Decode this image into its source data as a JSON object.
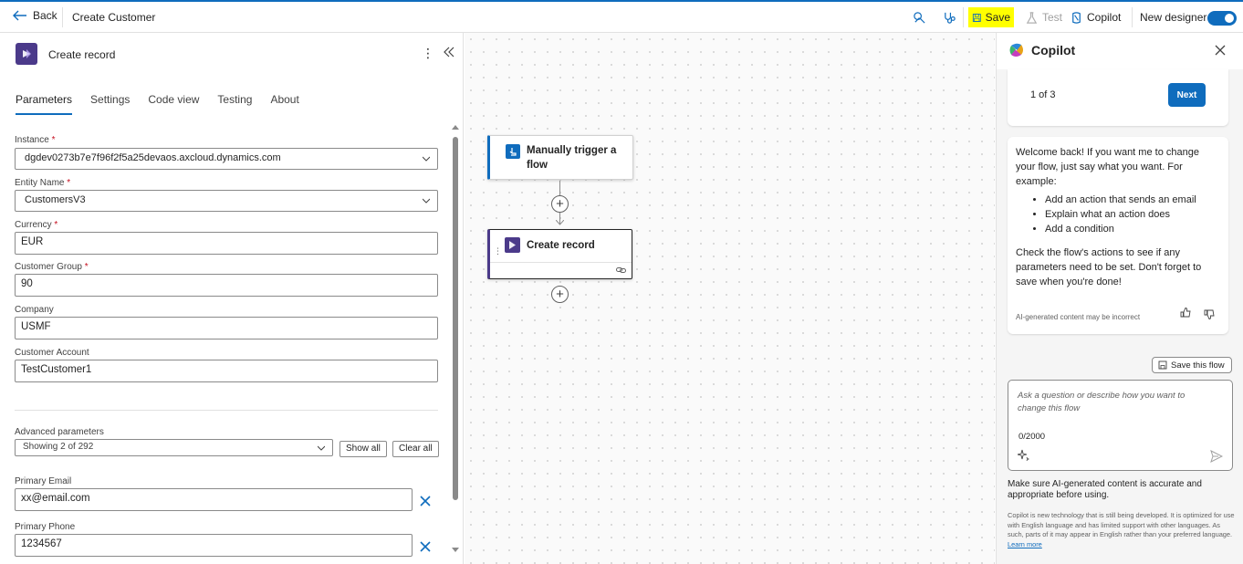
{
  "topbar": {
    "back_label": "Back",
    "title": "Create Customer",
    "save_label": "Save",
    "test_label": "Test",
    "copilot_label": "Copilot",
    "new_designer_label": "New designer",
    "new_designer_on": true
  },
  "panel": {
    "title": "Create record",
    "tabs": [
      "Parameters",
      "Settings",
      "Code view",
      "Testing",
      "About"
    ],
    "fields": {
      "instance": {
        "label": "Instance",
        "value": "dgdev0273b7e7f96f2f5a25devaos.axcloud.dynamics.com"
      },
      "entity": {
        "label": "Entity Name",
        "value": "CustomersV3"
      },
      "currency": {
        "label": "Currency",
        "value": "EUR"
      },
      "customer_group": {
        "label": "Customer Group",
        "value": "90"
      },
      "company": {
        "label": "Company",
        "value": "USMF"
      },
      "customer_account": {
        "label": "Customer Account",
        "value": "TestCustomer1"
      },
      "primary_email": {
        "label": "Primary Email",
        "value": "xx@email.com"
      },
      "primary_phone": {
        "label": "Primary Phone",
        "value": "1234567"
      }
    },
    "required_mark": "*",
    "advanced": {
      "label": "Advanced parameters",
      "value": "Showing 2 of 292",
      "show_all": "Show all",
      "clear_all": "Clear all"
    }
  },
  "canvas": {
    "trigger_label": "Manually trigger a flow",
    "action_label": "Create record"
  },
  "copilot": {
    "title": "Copilot",
    "pager": "1 of 3",
    "next_label": "Next",
    "welcome": "Welcome back! If you want me to change your flow, just say what you want. For example:",
    "examples": [
      "Add an action that sends an email",
      "Explain what an action does",
      "Add a condition"
    ],
    "check": "Check the flow's actions to see if any parameters need to be set. Don't forget to save when you're done!",
    "ai_note": "AI-generated content may be incorrect",
    "save_flow": "Save this flow",
    "input_placeholder": "Ask a question or describe how you want to change this flow",
    "counter": "0/2000",
    "disclaimer": "Make sure AI-generated content is accurate and appropriate before using.",
    "footnote": "Copilot is new technology that is still being developed. It is optimized for use with English language and has limited support with other languages. As such, parts of it may appear in English rather than your preferred language.",
    "learn_more": "Learn more"
  },
  "colors": {
    "accent": "#0f6cbd",
    "highlight": "#ffff00",
    "dynamics_purple": "#4b3a8a",
    "required": "#c50f1f"
  }
}
